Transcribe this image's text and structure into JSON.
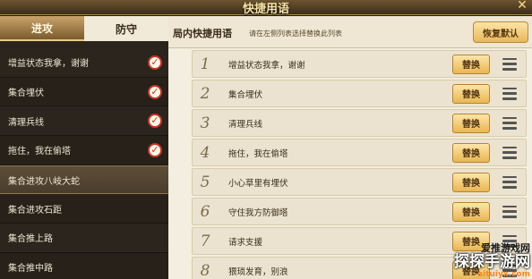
{
  "window": {
    "title": "快捷用语",
    "close_icon": "close-icon"
  },
  "left_panel": {
    "tabs": [
      {
        "label": "进攻",
        "active": true
      },
      {
        "label": "防守",
        "active": false
      }
    ],
    "items": [
      {
        "label": "增益状态我拿，谢谢",
        "checked": true,
        "selected": false
      },
      {
        "label": "集合埋伏",
        "checked": true,
        "selected": false
      },
      {
        "label": "清理兵线",
        "checked": true,
        "selected": false
      },
      {
        "label": "拖住，我在偷塔",
        "checked": true,
        "selected": false
      },
      {
        "label": "集合进攻八岐大蛇",
        "checked": false,
        "selected": true
      },
      {
        "label": "集合进攻石距",
        "checked": false,
        "selected": false
      },
      {
        "label": "集合推上路",
        "checked": false,
        "selected": false
      },
      {
        "label": "集合推中路",
        "checked": false,
        "selected": false
      }
    ]
  },
  "right_panel": {
    "title": "局内快捷用语",
    "hint": "请在左侧列表选择替换此列表",
    "restore_label": "恢复默认",
    "swap_label": "替换",
    "rows": [
      {
        "num": "1",
        "text": "增益状态我拿，谢谢"
      },
      {
        "num": "2",
        "text": "集合埋伏"
      },
      {
        "num": "3",
        "text": "清理兵线"
      },
      {
        "num": "4",
        "text": "拖住，我在偷塔"
      },
      {
        "num": "5",
        "text": "小心草里有埋伏"
      },
      {
        "num": "6",
        "text": "守住我方防御塔"
      },
      {
        "num": "7",
        "text": "请求支援"
      },
      {
        "num": "8",
        "text": "猥琐发育，别浪"
      }
    ]
  },
  "watermark": {
    "line1": "爱推游戏网",
    "line2": "探探手游网",
    "url": "aituiyx.com"
  },
  "colors": {
    "accent": "#e9b653",
    "check": "#c0392b",
    "panel_dark": "#2a241c",
    "panel_light": "#f4eee0"
  }
}
